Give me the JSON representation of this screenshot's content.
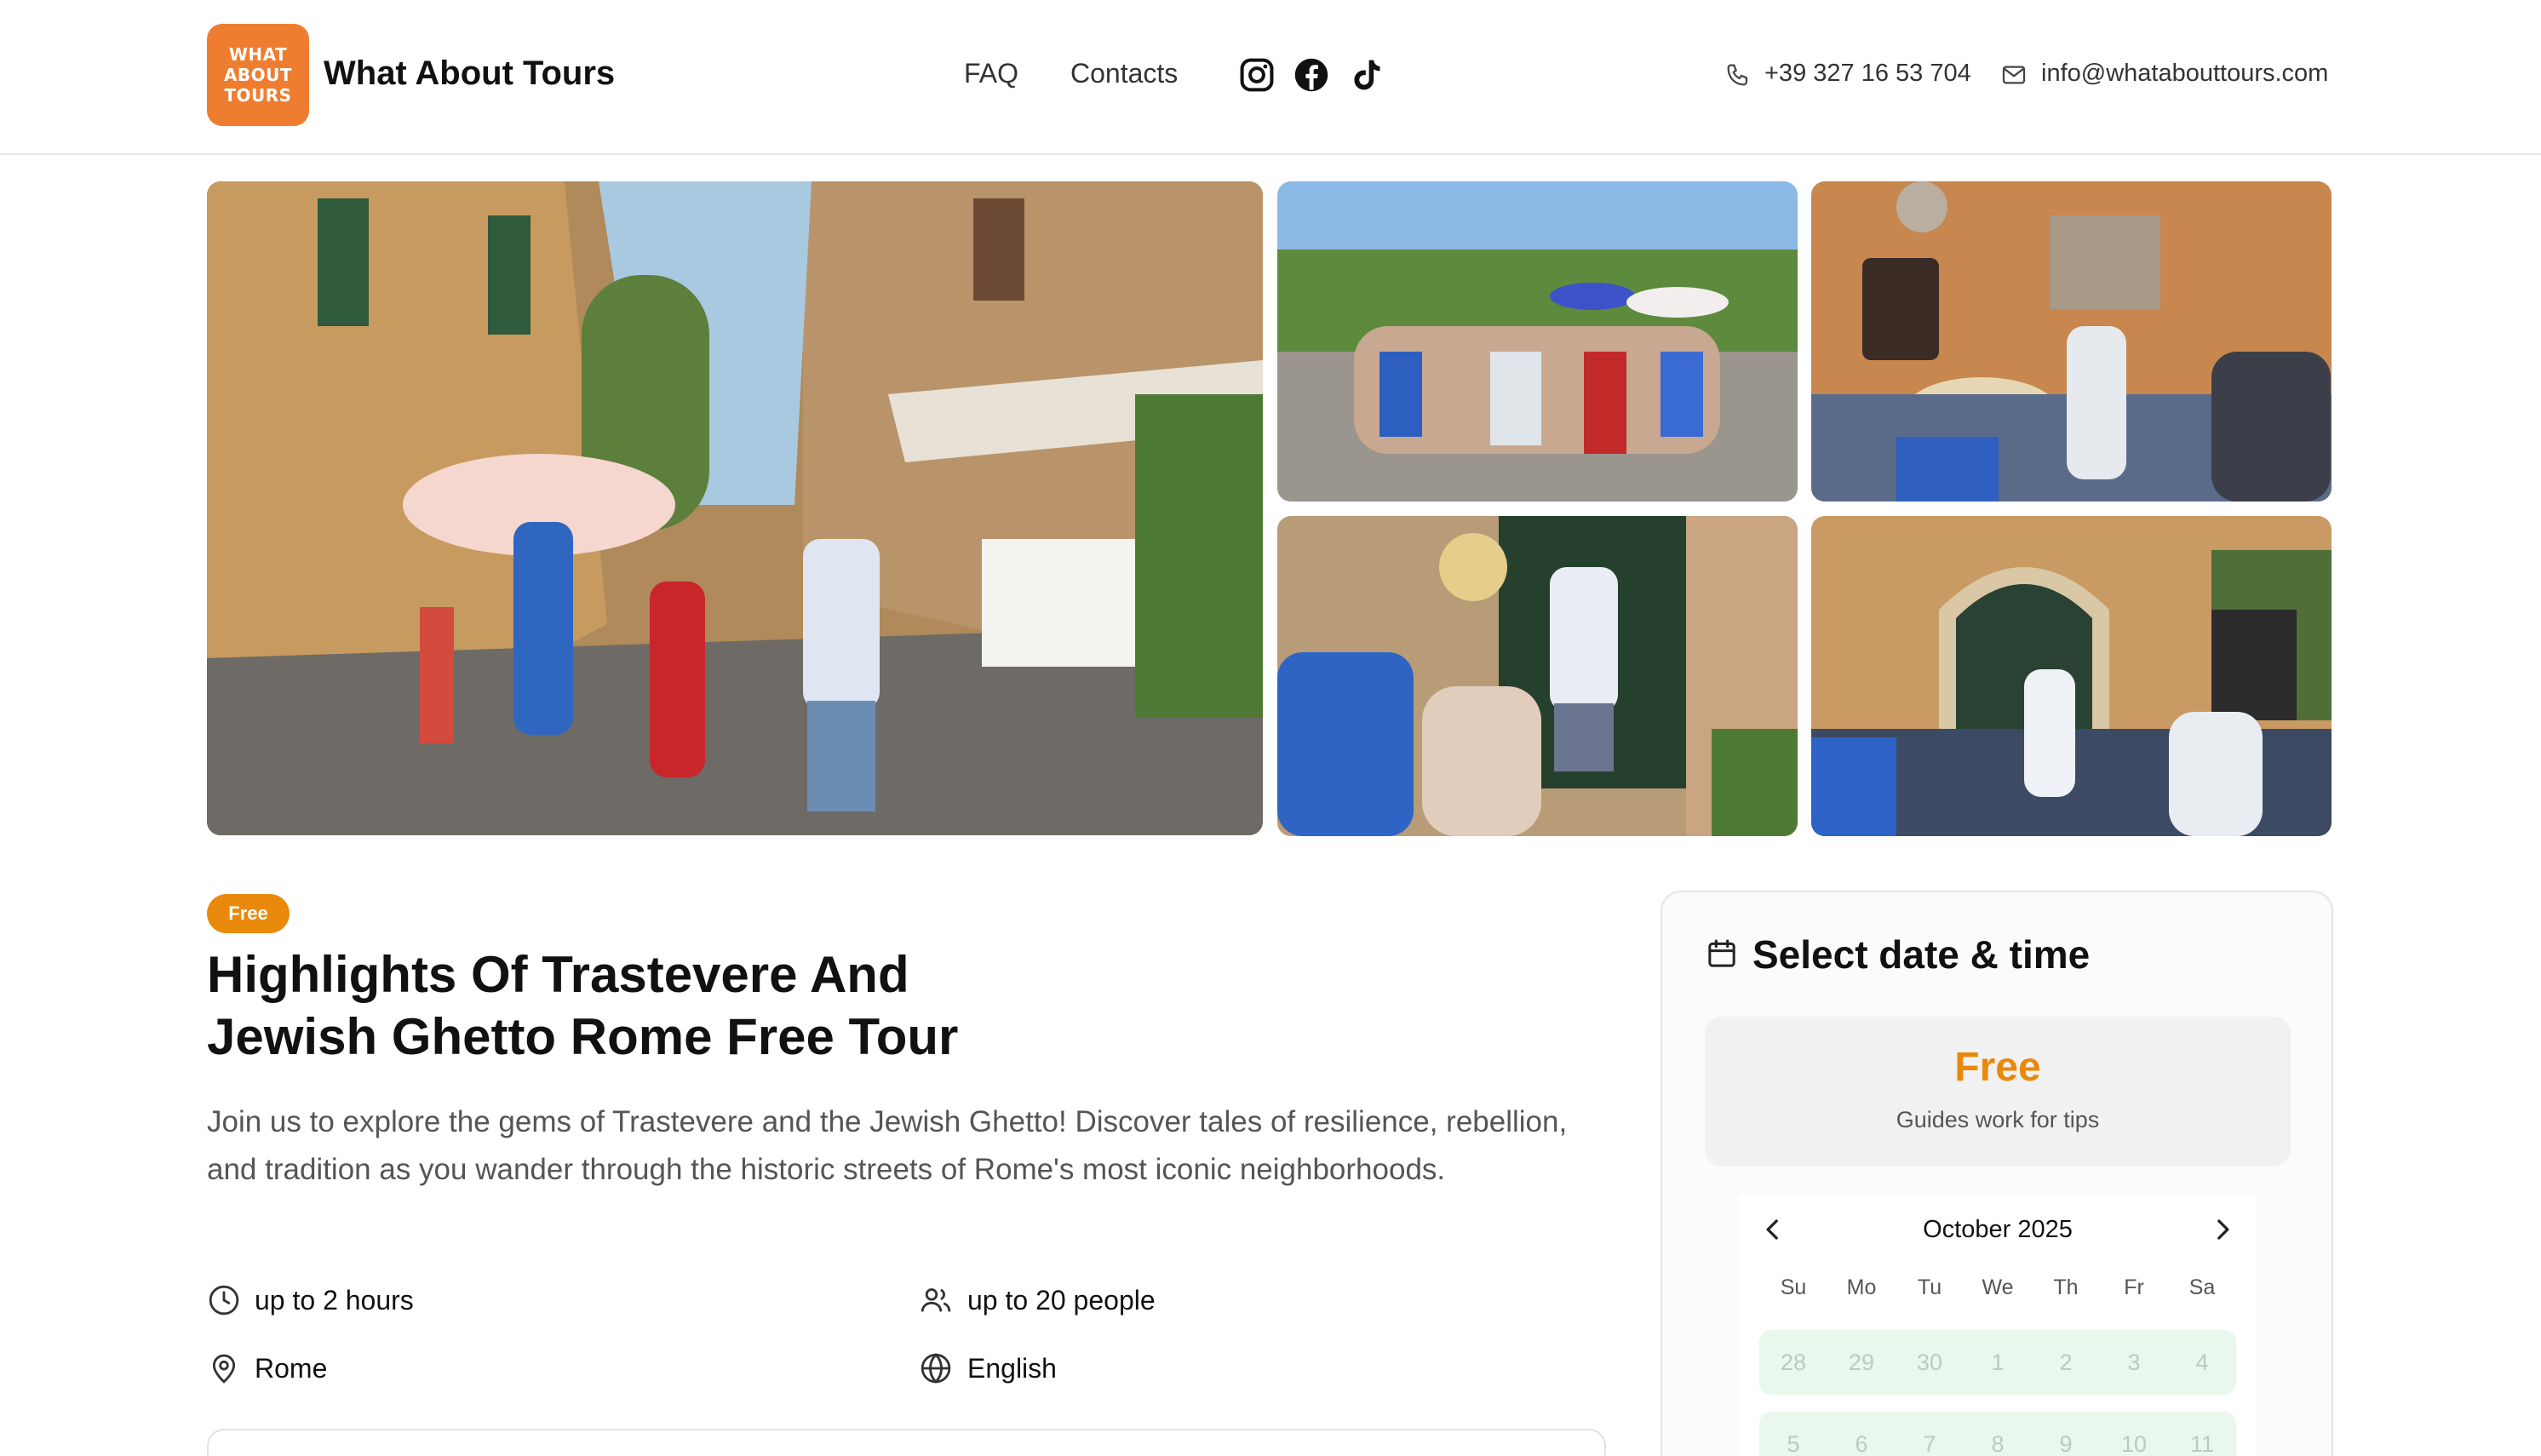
{
  "header": {
    "logo_lines": [
      "WHAT",
      "ABOUT",
      "TOURS"
    ],
    "brand": "What About Tours",
    "nav": [
      "FAQ",
      "Contacts"
    ],
    "social_icons": [
      "instagram-icon",
      "facebook-icon",
      "tiktok-icon"
    ],
    "phone": "+39 327 16 53 704",
    "email": "info@whatabouttours.com"
  },
  "gallery": {
    "photos": [
      "trastevere-street-photo",
      "group-photo",
      "ghetto-wall-photo",
      "guide-door-photo",
      "arched-door-photo"
    ]
  },
  "tour": {
    "badge": "Free",
    "title_line1": "Highlights Of Trastevere And",
    "title_line2": "Jewish Ghetto Rome Free Tour",
    "description": "Join us to explore the gems of Trastevere and the Jewish Ghetto! Discover tales of resilience, rebellion, and tradition as you wander through the historic streets of Rome's most iconic neighborhoods.",
    "features": {
      "duration": "up to 2 hours",
      "group_size": "up to 20 people",
      "location": "Rome",
      "language": "English"
    }
  },
  "booking": {
    "title": "Select date & time",
    "price": "Free",
    "price_note": "Guides work for tips",
    "calendar": {
      "month": "October 2025",
      "weekdays": [
        "Su",
        "Mo",
        "Tu",
        "We",
        "Th",
        "Fr",
        "Sa"
      ],
      "week1": [
        "28",
        "29",
        "30",
        "1",
        "2",
        "3",
        "4"
      ],
      "week2": [
        "5",
        "6",
        "7",
        "8",
        "9",
        "10",
        "11"
      ]
    }
  },
  "colors": {
    "accent": "#e8890c",
    "logo": "#ef7d2f",
    "day_bg": "#e9f7ec"
  }
}
